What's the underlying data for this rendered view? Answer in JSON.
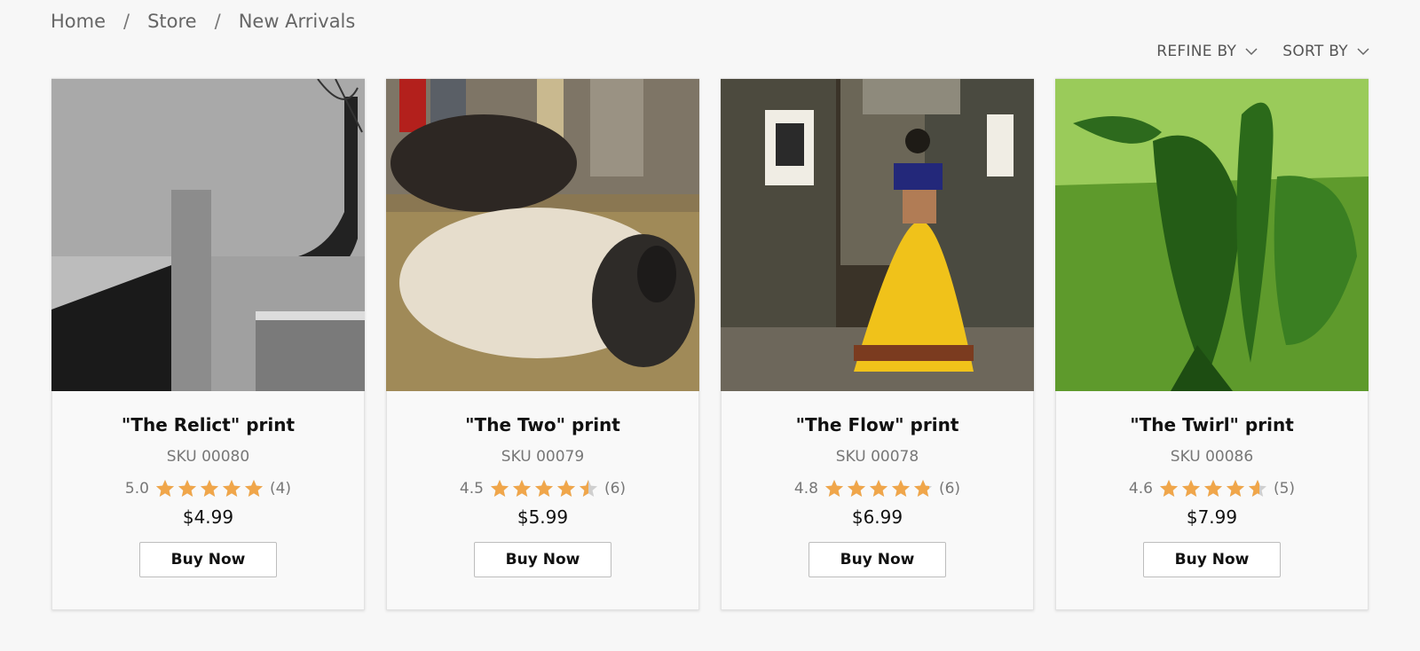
{
  "breadcrumb": {
    "items": [
      "Home",
      "Store",
      "New Arrivals"
    ],
    "separator": "/"
  },
  "toolbar": {
    "refine_label": "REFINE BY",
    "sort_label": "SORT BY"
  },
  "colors": {
    "star": "#f0a64a",
    "star_empty": "#cfcfcf",
    "background": "#f7f7f7"
  },
  "products": [
    {
      "title": "\"The Relict\" print",
      "sku": "SKU 00080",
      "rating": "5.0",
      "rating_value": 5.0,
      "reviews": "(4)",
      "price": "$4.99",
      "button": "Buy Now",
      "image_alt": "building-photo"
    },
    {
      "title": "\"The Two\" print",
      "sku": "SKU 00079",
      "rating": "4.5",
      "rating_value": 4.5,
      "reviews": "(6)",
      "price": "$5.99",
      "button": "Buy Now",
      "image_alt": "sheep-photo"
    },
    {
      "title": "\"The Flow\" print",
      "sku": "SKU 00078",
      "rating": "4.8",
      "rating_value": 4.8,
      "reviews": "(6)",
      "price": "$6.99",
      "button": "Buy Now",
      "image_alt": "dancer-photo"
    },
    {
      "title": "\"The Twirl\" print",
      "sku": "SKU 00086",
      "rating": "4.6",
      "rating_value": 4.6,
      "reviews": "(5)",
      "price": "$7.99",
      "button": "Buy Now",
      "image_alt": "plant-photo"
    }
  ]
}
